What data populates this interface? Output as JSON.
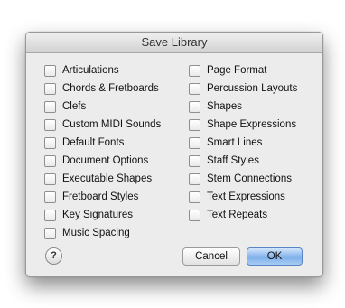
{
  "dialog": {
    "title": "Save Library",
    "left_items": [
      "Articulations",
      "Chords & Fretboards",
      "Clefs",
      "Custom MIDI Sounds",
      "Default Fonts",
      "Document Options",
      "Executable Shapes",
      "Fretboard Styles",
      "Key Signatures",
      "Music Spacing"
    ],
    "right_items": [
      "Page Format",
      "Percussion Layouts",
      "Shapes",
      "Shape Expressions",
      "Smart Lines",
      "Staff Styles",
      "Stem Connections",
      "Text Expressions",
      "Text Repeats"
    ],
    "help_label": "?",
    "cancel_label": "Cancel",
    "ok_label": "OK"
  }
}
